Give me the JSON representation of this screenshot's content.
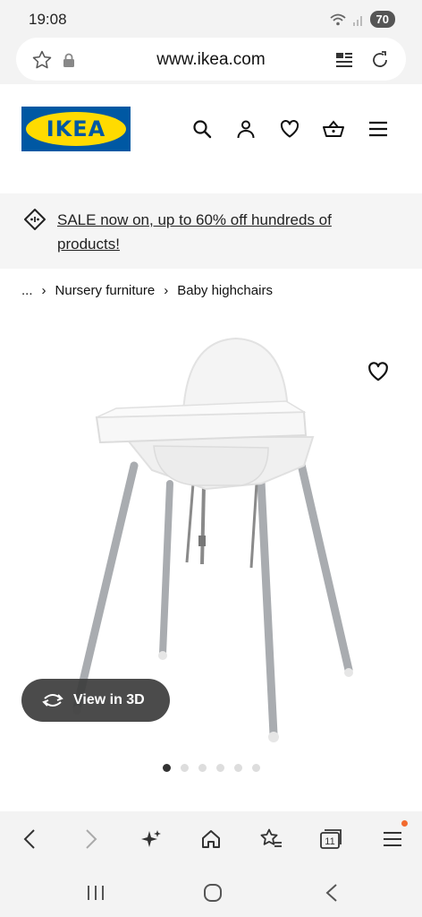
{
  "status_bar": {
    "time": "19:08",
    "battery": "70"
  },
  "browser": {
    "url": "www.ikea.com"
  },
  "header": {
    "logo_text": "IKEA"
  },
  "sale_banner": {
    "text": "SALE now on, up to 60% off hundreds of products!"
  },
  "breadcrumb": {
    "ellipsis": "...",
    "separator": "›",
    "items": [
      "Nursery furniture",
      "Baby highchairs"
    ]
  },
  "product": {
    "view_3d_label": "View in 3D",
    "gallery_count": 6,
    "gallery_active": 0
  },
  "toolbar": {
    "tabs_count": "11"
  },
  "colors": {
    "ikea_blue": "#0058a3",
    "ikea_yellow": "#ffdb00",
    "notification": "#f26a2e"
  },
  "icons": [
    "star-icon",
    "lock-icon",
    "reader-icon",
    "reload-icon",
    "search-icon",
    "user-icon",
    "heart-icon",
    "basket-icon",
    "menu-icon",
    "sale-tag-icon",
    "rotate-3d-icon",
    "back-icon",
    "forward-icon",
    "sparkle-icon",
    "home-icon",
    "bookmarks-icon",
    "tabs-icon"
  ]
}
